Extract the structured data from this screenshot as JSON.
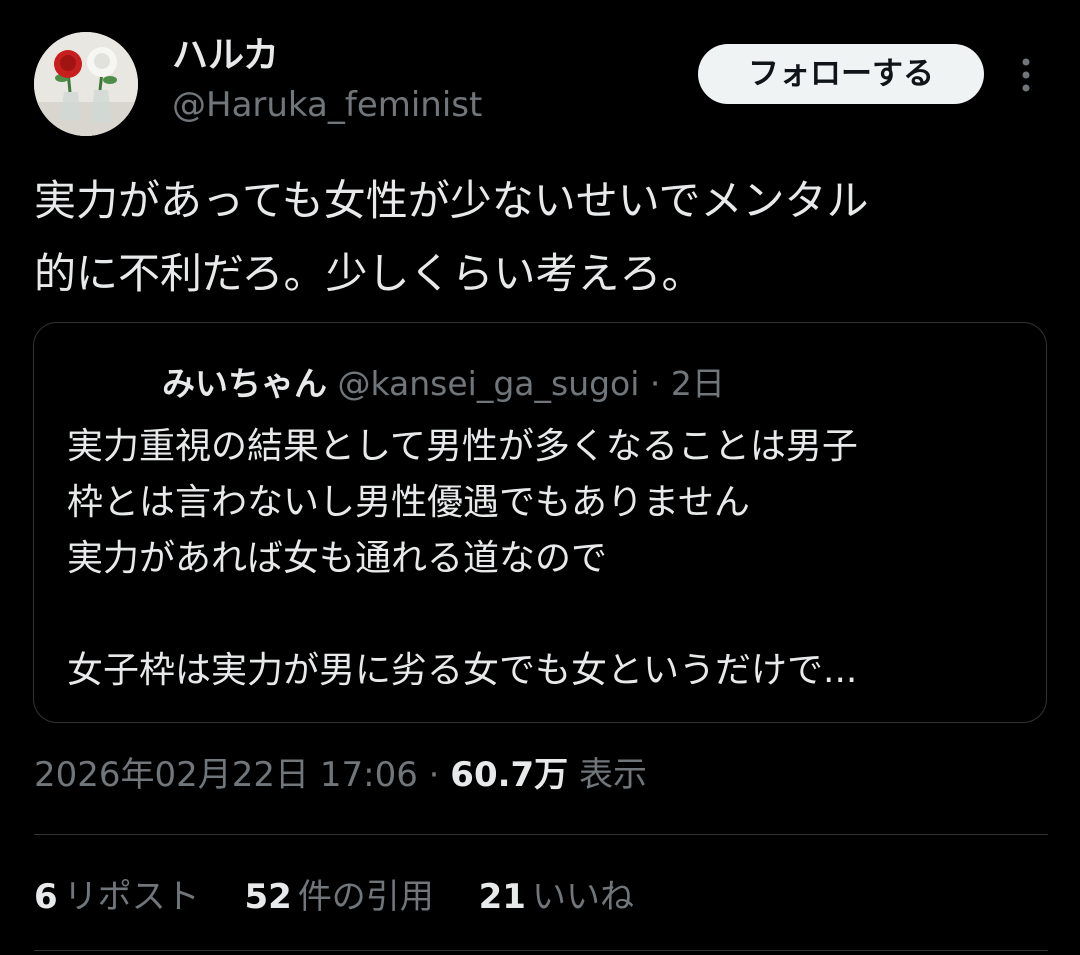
{
  "tweet": {
    "author": {
      "display_name": "ハルカ",
      "handle": "@Haruka_feminist"
    },
    "follow_label": "フォローする",
    "more_icon": "more-vertical-icon",
    "text": "実力があっても女性が少ないせいでメンタル\n的に不利だろ。少しくらい考えろ。",
    "quote": {
      "display_name": "みいちゃん",
      "handle": "@kansei_ga_sugoi",
      "sep": " · ",
      "time": "2日",
      "text": "実力重視の結果として男性が多くなることは男子\n枠とは言わないし男性優遇でもありません\n実力があれば女も通れる道なので\n\n女子枠は実力が男に劣る女でも女というだけで..."
    },
    "timestamp": "2026年02月22日 17:06",
    "sep": " · ",
    "views_count": "60.7万",
    "views_label": "表示",
    "stats": [
      {
        "count": "6",
        "label": "リポスト"
      },
      {
        "count": "52",
        "label": "件の引用"
      },
      {
        "count": "21",
        "label": "いいね"
      }
    ]
  },
  "colors": {
    "background": "#000000",
    "text_primary": "#e7e9ea",
    "text_secondary": "#71767b",
    "border": "#2f3336",
    "follow_bg": "#eff3f4"
  }
}
